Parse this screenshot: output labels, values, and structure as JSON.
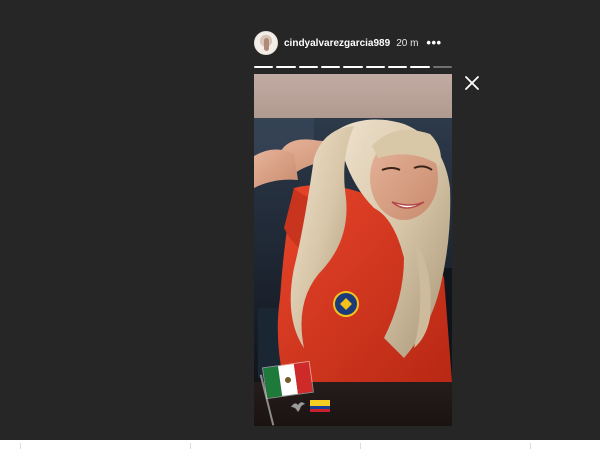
{
  "story": {
    "username": "cindyalvarezgarcia989",
    "time": "20 m",
    "more_label": "•••",
    "progress_segments": 9,
    "progress_completed": 8
  },
  "icons": {
    "close": "close-icon",
    "more": "more-options-icon",
    "flag_mexico": "mexico-flag-icon",
    "flag_colombia": "colombia-flag-icon",
    "eagle": "eagle-icon"
  },
  "colors": {
    "viewer_background": "#262626",
    "jersey": "#d8341d",
    "mexico_green": "#1d7a3a",
    "mexico_red": "#cf2a2a",
    "colombia_yellow": "#f6cd20",
    "colombia_blue": "#1c3f94",
    "colombia_red": "#c9202d"
  }
}
